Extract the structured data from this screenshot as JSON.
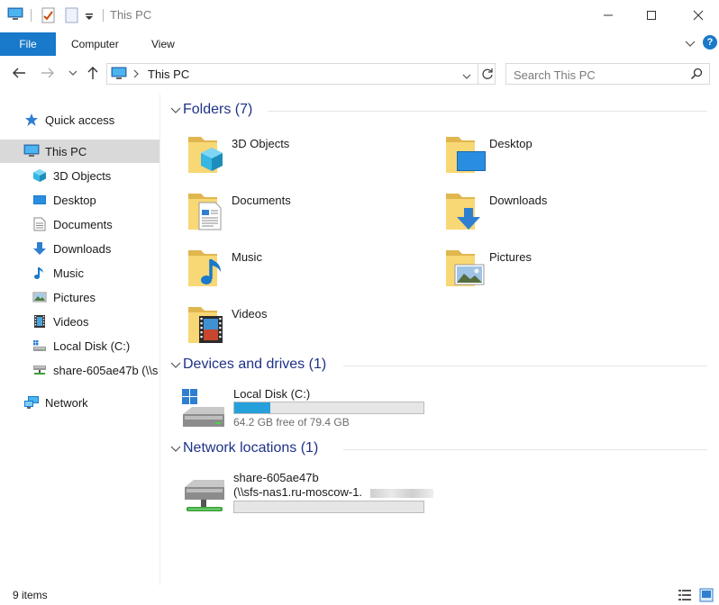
{
  "window": {
    "title": "This PC",
    "minimize": "minimize",
    "maximize": "maximize",
    "close": "close"
  },
  "ribbon": {
    "tabs": [
      "File",
      "Computer",
      "View"
    ],
    "help": "?"
  },
  "nav": {
    "address": "This PC",
    "search_placeholder": "Search This PC"
  },
  "sidebar": {
    "items": [
      {
        "label": "Quick access",
        "icon": "star-icon"
      },
      {
        "label": "This PC",
        "icon": "computer-icon"
      },
      {
        "label": "3D Objects",
        "icon": "cube-icon"
      },
      {
        "label": "Desktop",
        "icon": "desktop-icon"
      },
      {
        "label": "Documents",
        "icon": "document-icon"
      },
      {
        "label": "Downloads",
        "icon": "download-arrow-icon"
      },
      {
        "label": "Music",
        "icon": "music-note-icon"
      },
      {
        "label": "Pictures",
        "icon": "picture-icon"
      },
      {
        "label": "Videos",
        "icon": "film-icon"
      },
      {
        "label": "Local Disk (C:)",
        "icon": "drive-icon"
      },
      {
        "label": "share-605ae47b (\\\\s",
        "icon": "network-drive-icon"
      },
      {
        "label": "Network",
        "icon": "network-icon"
      }
    ]
  },
  "groups": {
    "folders": "Folders (7)",
    "devices": "Devices and drives (1)",
    "network": "Network locations (1)"
  },
  "folders": [
    {
      "label": "3D Objects"
    },
    {
      "label": "Desktop"
    },
    {
      "label": "Documents"
    },
    {
      "label": "Downloads"
    },
    {
      "label": "Music"
    },
    {
      "label": "Pictures"
    },
    {
      "label": "Videos"
    }
  ],
  "drives": [
    {
      "name": "Local Disk (C:)",
      "free": "64.2 GB free of 79.4 GB",
      "used_fraction": 0.19
    }
  ],
  "network_locations": [
    {
      "name": "share-605ae47b",
      "path": "(\\\\sfs-nas1.ru-moscow-1.",
      "used_fraction": 0
    }
  ],
  "status": {
    "items": "9 items"
  },
  "colors": {
    "accent": "#1979ca",
    "group_title": "#1e3287",
    "selection": "#d9d9d9",
    "drive_fill": "#26a0da",
    "folder": "#f8d775"
  }
}
